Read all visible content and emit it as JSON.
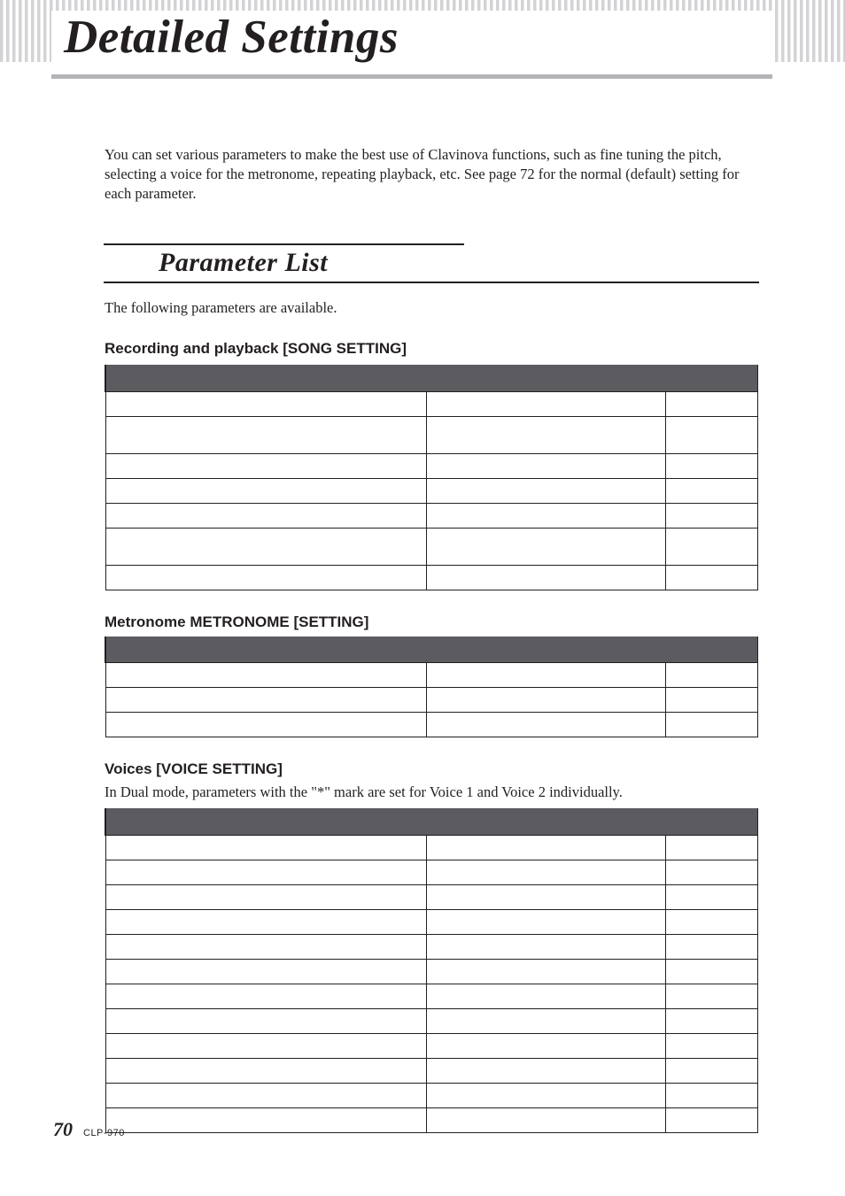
{
  "page_title": "Detailed Settings",
  "intro": "You can set various parameters to make the best use of Clavinova functions, such as fine tuning the pitch, selecting a voice for the metronome, repeating playback, etc. See page 72 for the normal (default) setting for each parameter.",
  "section_heading": "Parameter List",
  "sub_intro": "The following parameters are available.",
  "tables": {
    "song": {
      "title": "Recording and playback [SONG SETTING]"
    },
    "metronome": {
      "title": "Metronome METRONOME [SETTING]"
    },
    "voice": {
      "title": "Voices [VOICE SETTING]",
      "note": "In Dual mode, parameters with the \"*\" mark are set for Voice 1 and Voice 2 individually."
    }
  },
  "footer": {
    "page_number": "70",
    "model": "CLP-970"
  }
}
